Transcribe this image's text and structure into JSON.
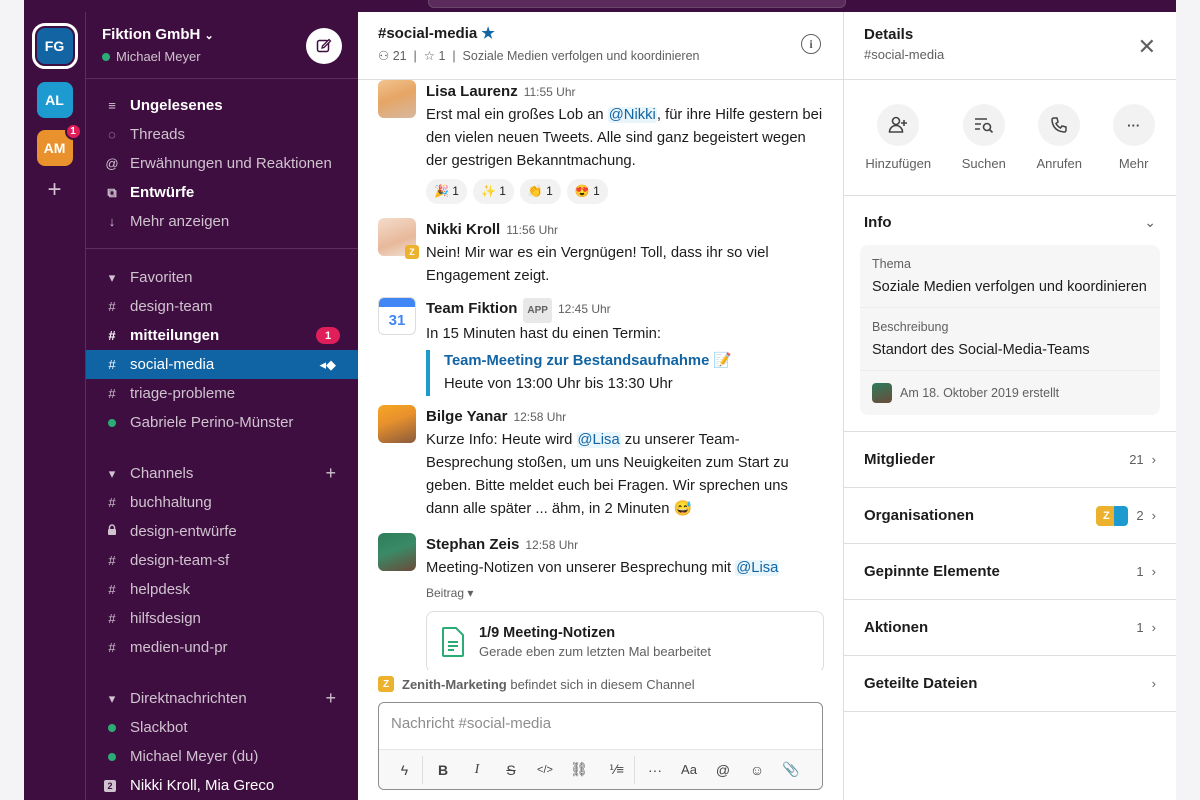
{
  "workspaces": [
    {
      "initials": "FG",
      "color": "#1264a3"
    },
    {
      "initials": "AL",
      "color": "#1d9bd1"
    },
    {
      "initials": "AM",
      "color": "#e8912d",
      "badge": "1"
    }
  ],
  "sidebar": {
    "team_name": "Fiktion GmbH",
    "user_name": "Michael Meyer",
    "top_items": [
      {
        "icon": "≡",
        "label": "Ungelesenes"
      },
      {
        "icon": "◌",
        "label": "Threads"
      },
      {
        "icon": "@",
        "label": "Erwähnungen und Reaktionen"
      },
      {
        "icon": "⧉",
        "label": "Entwürfe"
      },
      {
        "icon": "↓",
        "label": "Mehr anzeigen"
      }
    ],
    "favorites_header": "Favoriten",
    "favorites": [
      {
        "prefix": "#",
        "label": "design-team"
      },
      {
        "prefix": "#",
        "label": "mitteilungen",
        "badge": "1"
      },
      {
        "prefix": "#",
        "label": "social-media"
      },
      {
        "prefix": "#",
        "label": "triage-probleme"
      },
      {
        "prefix": "●",
        "label": "Gabriele Perino-Münster"
      }
    ],
    "channels_header": "Channels",
    "channels": [
      {
        "prefix": "#",
        "label": "buchhaltung"
      },
      {
        "prefix": "🔒",
        "label": "design-entwürfe"
      },
      {
        "prefix": "#",
        "label": "design-team-sf"
      },
      {
        "prefix": "#",
        "label": "helpdesk"
      },
      {
        "prefix": "#",
        "label": "hilfsdesign"
      },
      {
        "prefix": "#",
        "label": "medien-und-pr"
      }
    ],
    "dm_header": "Direktnachrichten",
    "dms": [
      {
        "label": "Slackbot"
      },
      {
        "label": "Michael Meyer (du)"
      },
      {
        "label": "Nikki Kroll, Mia Greco",
        "box": "2"
      }
    ]
  },
  "channel": {
    "name": "#social-media",
    "members": "21",
    "pins": "1",
    "topic": "Soziale Medien verfolgen und koordinieren"
  },
  "messages": {
    "lisa": {
      "name": "Lisa Laurenz",
      "time": "11:55 Uhr",
      "t1": "Erst mal ein großes Lob an ",
      "mention": "@Nikki",
      "t2": ", für ihre Hilfe gestern bei den vielen neuen Tweets. Alle sind ganz begeistert wegen der gestrigen Bekanntmachung.",
      "reactions": [
        "🎉 1",
        "✨ 1",
        "👏 1",
        "😍 1"
      ]
    },
    "nikki": {
      "name": "Nikki Kroll",
      "time": "11:56 Uhr",
      "text": "Nein! Mir war es ein Vergnügen! Toll, dass ihr so viel Engagement zeigt."
    },
    "team": {
      "name": "Team Fiktion",
      "tag": "APP",
      "time": "12:45 Uhr",
      "text": "In 15 Minuten hast du einen Termin:",
      "link": "Team-Meeting zur Bestandsaufnahme 📝",
      "when": "Heute von 13:00 Uhr bis 13:30 Uhr",
      "cal_day": "31"
    },
    "bilge": {
      "name": "Bilge Yanar",
      "time": "12:58 Uhr",
      "t1": "Kurze Info: Heute wird ",
      "mention": "@Lisa",
      "t2": " zu unserer Team-Besprechung stoßen, um uns Neuigkeiten zum Start zu geben. Bitte meldet euch bei Fragen. Wir sprechen uns dann alle später ... ähm, in 2 Minuten 😅"
    },
    "stephan": {
      "name": "Stephan Zeis",
      "time": "12:58 Uhr",
      "t1": "Meeting-Notizen von unserer Besprechung mit ",
      "mention": "@Lisa",
      "post_label": "Beitrag ▾",
      "file_title": "1/9 Meeting-Notizen",
      "file_sub": "Gerade eben zum letzten Mal bearbeitet"
    }
  },
  "org_note": {
    "org": "Zenith-Marketing",
    "text": " befindet sich in diesem Channel",
    "badge": "Z"
  },
  "composer": {
    "placeholder": "Nachricht #social-media"
  },
  "details": {
    "title": "Details",
    "subtitle": "#social-media",
    "actions": [
      {
        "label": "Hinzufügen",
        "icon": "add-person-icon"
      },
      {
        "label": "Suchen",
        "icon": "search-list-icon"
      },
      {
        "label": "Anrufen",
        "icon": "phone-icon"
      },
      {
        "label": "Mehr",
        "icon": "more-icon"
      }
    ],
    "info_title": "Info",
    "topic_label": "Thema",
    "topic_value": "Soziale Medien verfolgen und koordinieren",
    "desc_label": "Beschreibung",
    "desc_value": "Standort des Social-Media-Teams",
    "created": "Am 18. Oktober 2019 erstellt",
    "rows": [
      {
        "label": "Mitglieder",
        "value": "21"
      },
      {
        "label": "Organisationen",
        "value": "2"
      },
      {
        "label": "Gepinnte Elemente",
        "value": "1"
      },
      {
        "label": "Aktionen",
        "value": "1"
      },
      {
        "label": "Geteilte Dateien",
        "value": ""
      }
    ]
  }
}
